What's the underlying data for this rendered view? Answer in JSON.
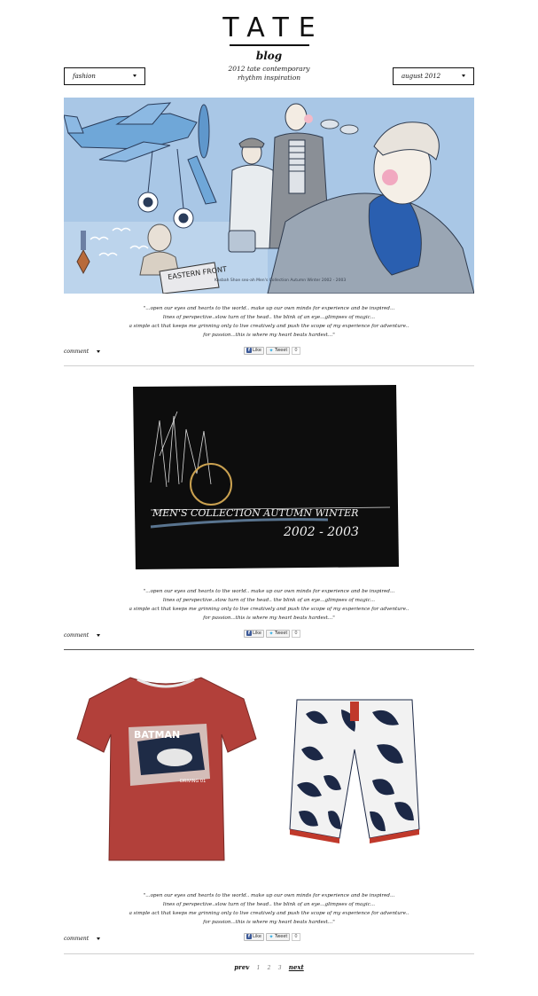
{
  "header": {
    "logo": "TATE",
    "blog_title": "blog",
    "tagline_line1": "2012 tate contemporary",
    "tagline_line2": "rhythm inspiration",
    "category_select": "fashion",
    "date_select": "august 2012"
  },
  "quote": {
    "line1": "\"...open our eyes and hearts to the world.. make up our own minds for experience and be inspired...",
    "line2": "lines of perspective..slow turn of the head.. the blink of an eye...glimpses of magic...",
    "line3": "a simple act that keeps me grinning only to live creatively and push the scope of my experience for adventure..",
    "line4": "for passion...this is where my heart beats hardest...\""
  },
  "posts": [
    {
      "illustration_caption": "EASTERN FRONT",
      "credit_text": "Kasbah Shoe seo-ah    Men's Collection Autumn Winter 2002 - 2003",
      "comment_label": "comment",
      "like_label": "Like",
      "tweet_label": "Tweet",
      "count": "0"
    },
    {
      "card_line1": "MEN'S COLLECTION AUTUMN WINTER",
      "card_line2": "2002 - 2003",
      "comment_label": "comment",
      "like_label": "Like",
      "tweet_label": "Tweet",
      "count": "0"
    },
    {
      "tshirt_text1": "BATMAN",
      "tshirt_text2": "DRIVING 01",
      "comment_label": "comment",
      "like_label": "Like",
      "tweet_label": "Tweet",
      "count": "0"
    }
  ],
  "pager": {
    "prev": "prev",
    "pages": [
      "1",
      "2",
      "3"
    ],
    "next": "next"
  },
  "colors": {
    "illustration_sky": "#a9c7e6",
    "plane_blue": "#6fa7d8",
    "card_black": "#0d0d0d",
    "tshirt_red": "#b2403a",
    "shorts_navy": "#1c2846",
    "facebook_blue": "#3b5998",
    "twitter_blue": "#29a9e1"
  }
}
